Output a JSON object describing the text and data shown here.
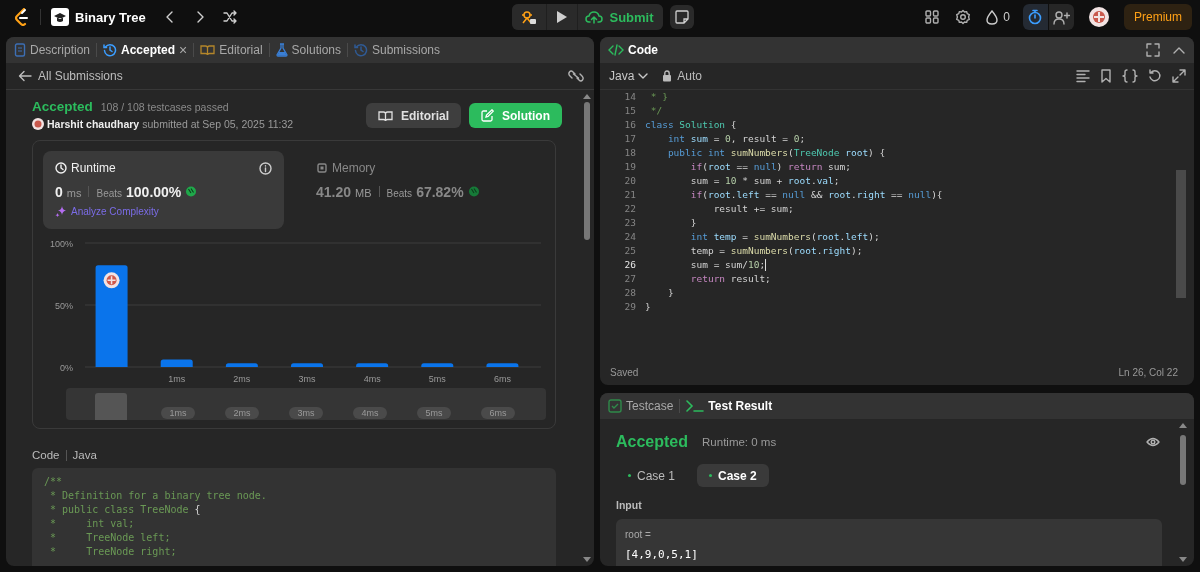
{
  "top_bar": {
    "problem_title": "Binary Tree",
    "submit": "Submit",
    "streak": "0",
    "premium": "Premium"
  },
  "left_panel": {
    "tabs": [
      {
        "label": "Description",
        "selected": false
      },
      {
        "label": "Accepted",
        "selected": true,
        "close": "×"
      },
      {
        "label": "Editorial",
        "selected": false
      },
      {
        "label": "Solutions",
        "selected": false
      },
      {
        "label": "Submissions",
        "selected": false
      }
    ],
    "back_link": "All Submissions",
    "submission": {
      "status": "Accepted",
      "testcases": "108 / 108 testcases passed",
      "user": "Harshit chaudhary",
      "submitted": "submitted at Sep 05, 2025 11:32",
      "editorial_button": "Editorial",
      "solution_button": "Solution"
    },
    "stats": [
      {
        "kind": "runtime",
        "title": "Runtime",
        "value": "0",
        "unit": "ms",
        "beats_label": "Beats",
        "beats": "100.00%",
        "selected": true,
        "link": "Analyze Complexity"
      },
      {
        "kind": "memory",
        "title": "Memory",
        "value": "41.20",
        "unit": "MB",
        "beats_label": "Beats",
        "beats": "67.82%",
        "selected": false
      }
    ],
    "chart_data": {
      "type": "bar",
      "categories": [
        null,
        "1ms",
        "2ms",
        "3ms",
        "4ms",
        "5ms",
        "6ms"
      ],
      "ylim": [
        0,
        100
      ],
      "yticks": [
        {
          "value": 0,
          "label": "0%"
        },
        {
          "value": 50,
          "label": "50%"
        },
        {
          "value": 100,
          "label": "100%"
        }
      ],
      "series": [
        {
          "color": "#0a74eb",
          "values": [
            82,
            6,
            3,
            3,
            3,
            3,
            3
          ]
        }
      ]
    },
    "navigator_labels": [
      "1ms",
      "2ms",
      "3ms",
      "4ms",
      "5ms",
      "6ms"
    ],
    "code_section": {
      "label": "Code",
      "language": "Java",
      "lines": [
        [
          {
            "kind": "comment",
            "text": "/**"
          }
        ],
        [
          {
            "kind": "comment",
            "text": " * Definition for a binary tree node."
          }
        ],
        [
          {
            "kind": "comment",
            "text": " * public class TreeNode "
          },
          {
            "kind": "plain",
            "text": "{"
          }
        ],
        [
          {
            "kind": "comment",
            "text": " *     int val;"
          }
        ],
        [
          {
            "kind": "comment",
            "text": " *     TreeNode left;"
          }
        ],
        [
          {
            "kind": "comment",
            "text": " *     TreeNode right;"
          }
        ]
      ]
    }
  },
  "editor": {
    "title": "Code",
    "language": "Java",
    "mode": "Auto",
    "lines": [
      {
        "number": "14",
        "current": false,
        "tokens": [
          {
            "kind": "comment",
            "text": " * }"
          }
        ]
      },
      {
        "number": "15",
        "current": false,
        "tokens": [
          {
            "kind": "comment",
            "text": " */"
          }
        ]
      },
      {
        "number": "16",
        "current": false,
        "tokens": [
          {
            "kind": "keyword",
            "text": "class "
          },
          {
            "kind": "type",
            "text": "Solution"
          },
          {
            "kind": "plain",
            "text": " {"
          }
        ]
      },
      {
        "number": "17",
        "current": false,
        "tokens": [
          {
            "kind": "keyword",
            "text": "    int "
          },
          {
            "kind": "variable",
            "text": "sum"
          },
          {
            "kind": "plain",
            "text": " = "
          },
          {
            "kind": "number",
            "text": "0"
          },
          {
            "kind": "plain",
            "text": ", result = "
          },
          {
            "kind": "number",
            "text": "0"
          },
          {
            "kind": "plain",
            "text": ";"
          }
        ]
      },
      {
        "number": "18",
        "current": false,
        "tokens": [
          {
            "kind": "keyword",
            "text": "    public int "
          },
          {
            "kind": "method",
            "text": "sumNumbers"
          },
          {
            "kind": "plain",
            "text": "("
          },
          {
            "kind": "type",
            "text": "TreeNode "
          },
          {
            "kind": "variable",
            "text": "root"
          },
          {
            "kind": "plain",
            "text": ") {"
          }
        ]
      },
      {
        "number": "19",
        "current": false,
        "tokens": [
          {
            "kind": "control",
            "text": "        if"
          },
          {
            "kind": "plain",
            "text": "("
          },
          {
            "kind": "variable",
            "text": "root"
          },
          {
            "kind": "plain",
            "text": " == "
          },
          {
            "kind": "keyword",
            "text": "null"
          },
          {
            "kind": "plain",
            "text": ") "
          },
          {
            "kind": "control",
            "text": "return"
          },
          {
            "kind": "plain",
            "text": " sum;"
          }
        ]
      },
      {
        "number": "20",
        "current": false,
        "tokens": [
          {
            "kind": "plain",
            "text": "        sum = "
          },
          {
            "kind": "number",
            "text": "10"
          },
          {
            "kind": "plain",
            "text": " * sum + "
          },
          {
            "kind": "variable",
            "text": "root"
          },
          {
            "kind": "plain",
            "text": "."
          },
          {
            "kind": "variable",
            "text": "val"
          },
          {
            "kind": "plain",
            "text": ";"
          }
        ]
      },
      {
        "number": "21",
        "current": false,
        "tokens": [
          {
            "kind": "control",
            "text": "        if"
          },
          {
            "kind": "plain",
            "text": "("
          },
          {
            "kind": "variable",
            "text": "root"
          },
          {
            "kind": "plain",
            "text": "."
          },
          {
            "kind": "variable",
            "text": "left"
          },
          {
            "kind": "plain",
            "text": " == "
          },
          {
            "kind": "keyword",
            "text": "null"
          },
          {
            "kind": "plain",
            "text": " && "
          },
          {
            "kind": "variable",
            "text": "root"
          },
          {
            "kind": "plain",
            "text": "."
          },
          {
            "kind": "variable",
            "text": "right"
          },
          {
            "kind": "plain",
            "text": " == "
          },
          {
            "kind": "keyword",
            "text": "null"
          },
          {
            "kind": "plain",
            "text": "){"
          }
        ]
      },
      {
        "number": "22",
        "current": false,
        "tokens": [
          {
            "kind": "plain",
            "text": "            result += sum;"
          }
        ]
      },
      {
        "number": "23",
        "current": false,
        "tokens": [
          {
            "kind": "plain",
            "text": "        }"
          }
        ]
      },
      {
        "number": "24",
        "current": false,
        "tokens": [
          {
            "kind": "keyword",
            "text": "        int "
          },
          {
            "kind": "variable",
            "text": "temp"
          },
          {
            "kind": "plain",
            "text": " = "
          },
          {
            "kind": "method",
            "text": "sumNumbers"
          },
          {
            "kind": "plain",
            "text": "("
          },
          {
            "kind": "variable",
            "text": "root"
          },
          {
            "kind": "plain",
            "text": "."
          },
          {
            "kind": "variable",
            "text": "left"
          },
          {
            "kind": "plain",
            "text": ");"
          }
        ]
      },
      {
        "number": "25",
        "current": false,
        "tokens": [
          {
            "kind": "plain",
            "text": "        temp = "
          },
          {
            "kind": "method",
            "text": "sumNumbers"
          },
          {
            "kind": "plain",
            "text": "("
          },
          {
            "kind": "variable",
            "text": "root"
          },
          {
            "kind": "plain",
            "text": "."
          },
          {
            "kind": "variable",
            "text": "right"
          },
          {
            "kind": "plain",
            "text": ");"
          }
        ]
      },
      {
        "number": "26",
        "current": true,
        "tokens": [
          {
            "kind": "plain",
            "text": "        sum = sum/"
          },
          {
            "kind": "number",
            "text": "10"
          },
          {
            "kind": "plain",
            "text": ";"
          }
        ]
      },
      {
        "number": "27",
        "current": false,
        "tokens": [
          {
            "kind": "control",
            "text": "        return"
          },
          {
            "kind": "plain",
            "text": " result;"
          }
        ]
      },
      {
        "number": "28",
        "current": false,
        "tokens": [
          {
            "kind": "plain",
            "text": "    }"
          }
        ]
      },
      {
        "number": "29",
        "current": false,
        "tokens": [
          {
            "kind": "plain",
            "text": "}"
          }
        ]
      }
    ],
    "status": "Saved",
    "position": "Ln 26, Col 22"
  },
  "result_panel": {
    "tabs": [
      {
        "label": "Testcase",
        "selected": false
      },
      {
        "label": "Test Result",
        "selected": true
      }
    ],
    "status": "Accepted",
    "runtime": "Runtime: 0 ms",
    "cases": [
      {
        "label": "Case 1",
        "selected": false
      },
      {
        "label": "Case 2",
        "selected": true
      }
    ],
    "input_label": "Input",
    "variable": "root =",
    "value": "[4,9,0,5,1]"
  }
}
